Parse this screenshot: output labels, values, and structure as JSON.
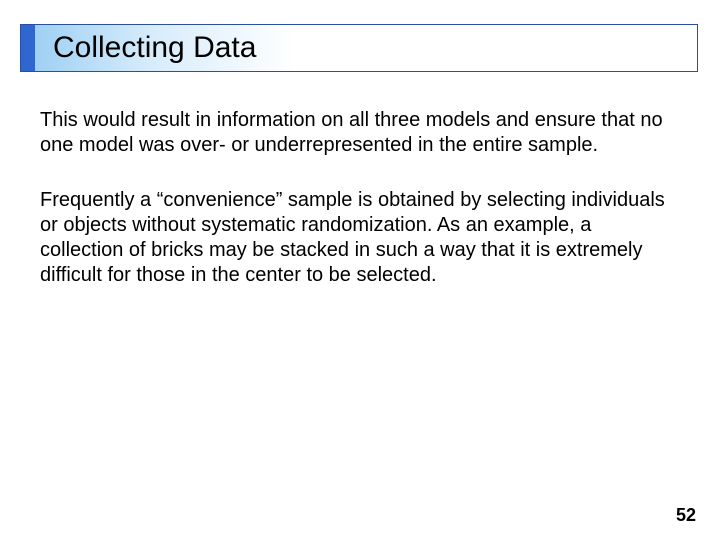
{
  "title": "Collecting Data",
  "paragraphs": [
    "This would result in information on all three models and ensure that no one model was over- or underrepresented in the entire sample.",
    "Frequently a “convenience” sample is obtained by selecting individuals or objects without systematic randomization. As an example, a collection of bricks may be stacked in such a way that it is extremely difficult for those in the center to be selected."
  ],
  "page_number": "52"
}
